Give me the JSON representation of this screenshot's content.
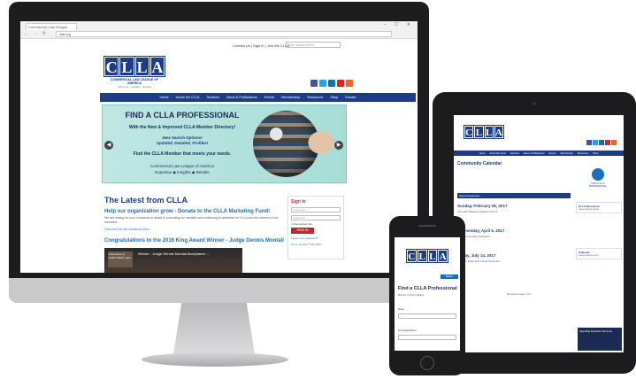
{
  "colors": {
    "brand_navy": "#1c3d85",
    "accent_red": "#c0272d",
    "link_blue": "#1c6fb8",
    "banner_teal": "#bfe7e3"
  },
  "browser": {
    "tab_title": "Commercial Law League",
    "address": "clla.org"
  },
  "site": {
    "top_links": "Contact Us | Sign In | Join the CLLA",
    "search_placeholder": "Enter search terms...",
    "logo_letters": [
      "C",
      "L",
      "L",
      "A"
    ],
    "logo_name": "COMMERCIAL LAW LEAGUE OF AMERICA",
    "logo_tagline": "Attorneys · Insights · Results",
    "social_icons": [
      "facebook-icon",
      "twitter-icon",
      "linkedin-icon",
      "youtube-icon",
      "rss-icon"
    ],
    "nav": [
      "Home",
      "About the CLLA",
      "Sections",
      "News & Publications",
      "Events",
      "Membership",
      "Resources",
      "Shop",
      "Donate"
    ]
  },
  "banner": {
    "title": "FIND A CLLA PROFESSIONAL",
    "line1": "With the New & Improved CLLA Member Directory!",
    "line2": "New Search Options!",
    "line3": "Updated, Detailed, Profiles!",
    "line4": "Find the CLLA Member that meets your needs.",
    "line5": "Commercial Law League of America",
    "line6": "Expertise ◆ Insights ◆ Results"
  },
  "latest": {
    "heading": "The Latest from CLLA",
    "post1_title": "Help our organization grow - Donate to the CLLA Marketing Fund!",
    "post1_text": "We are asking for your donations to assist in promoting our website and continuing to advertise for CLLA and the interest of our members.",
    "post1_link": "Click here for the donations form.",
    "post2_title": "Congratulations to the 2016 King Award Winner - Judge Dennis Montali",
    "video_title": "Winner - Judge Dennis Montali Acceptance ...",
    "video_thumb": "Full screen or watch Watch Later"
  },
  "signin": {
    "title": "Sign In",
    "username": "Username",
    "password": "Password",
    "remember": "Remember Me",
    "button": "SIGN IN",
    "forgot": "Forgot your password?",
    "not_member": "Not a member? Join Now!"
  },
  "ipad": {
    "title": "Community Calendar",
    "bar": "Upcoming Events",
    "events": [
      {
        "date": "Sunday, February 26, 2017",
        "sub": "CLLA 2017 Midyear Legislative Summit"
      },
      {
        "date": "Wednesday, April 5, 2017",
        "sub": "2017 CLLA Chicago Symposium"
      },
      {
        "date": "Friday, July 14, 2017",
        "sub": "Creditors' Rights 2017 Annual Convention"
      }
    ],
    "side_titles": [
      "CLLA Resources",
      "Calendar"
    ],
    "side_link": "Latest news & events",
    "pro_label": "FIND A CLLA PROFESSIONAL",
    "pagination": "Previous page 1 of 1",
    "ad_text": "Specialty Deposits Services"
  },
  "iphone": {
    "menu": "MENU",
    "title": "Find a CLLA Professional",
    "subtitle": "Member / Find by Radius",
    "label_name": "Name",
    "label_firm": "Firm/Organization"
  }
}
